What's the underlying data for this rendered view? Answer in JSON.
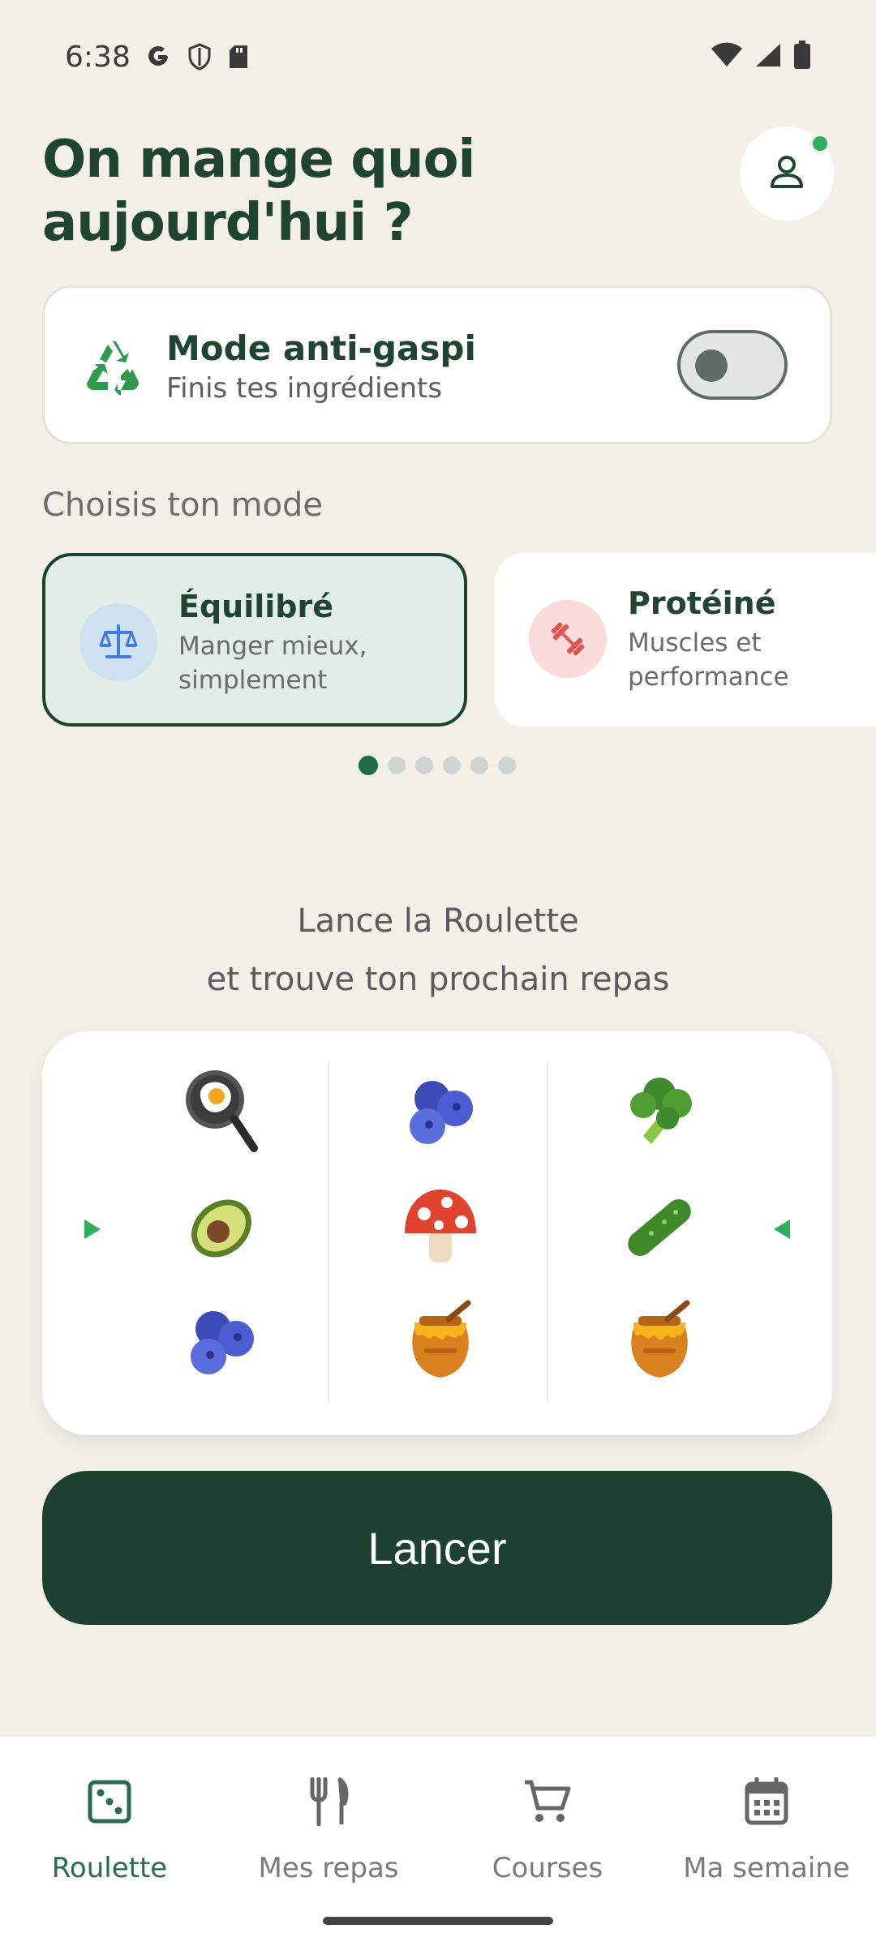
{
  "status_bar": {
    "time": "6:38"
  },
  "header": {
    "title": "On mange quoi aujourd'hui ?"
  },
  "antigaspi": {
    "title": "Mode anti-gaspi",
    "subtitle": "Finis tes ingrédients",
    "enabled": false
  },
  "modes": {
    "label": "Choisis ton mode",
    "items": [
      {
        "title": "Équilibré",
        "desc": "Manger mieux, simplement",
        "icon": "balance-scale-icon",
        "color": "#3f7be0",
        "selected": true
      },
      {
        "title": "Protéiné",
        "desc": "Muscles et performance",
        "icon": "dumbbell-icon",
        "color": "#e25353",
        "selected": false
      }
    ],
    "page_count": 6,
    "current_page": 1
  },
  "prompt": {
    "line1": "Lance la Roulette",
    "line2": "et trouve ton prochain repas"
  },
  "slots": {
    "reels": [
      [
        "fried-egg-icon",
        "avocado-icon",
        "blueberries-icon"
      ],
      [
        "blueberries-icon",
        "mushroom-icon",
        "honey-pot-icon"
      ],
      [
        "broccoli-icon",
        "cucumber-icon",
        "honey-pot-icon"
      ]
    ]
  },
  "launch_button": {
    "label": "Lancer"
  },
  "bottom_nav": {
    "items": [
      {
        "label": "Roulette",
        "icon": "dice-icon",
        "active": true
      },
      {
        "label": "Mes repas",
        "icon": "fork-knife-icon",
        "active": false
      },
      {
        "label": "Courses",
        "icon": "cart-icon",
        "active": false
      },
      {
        "label": "Ma semaine",
        "icon": "calendar-icon",
        "active": false
      }
    ]
  },
  "colors": {
    "accent": "#1c4130",
    "background": "#f3f0ea",
    "notification": "#2fae5d"
  }
}
